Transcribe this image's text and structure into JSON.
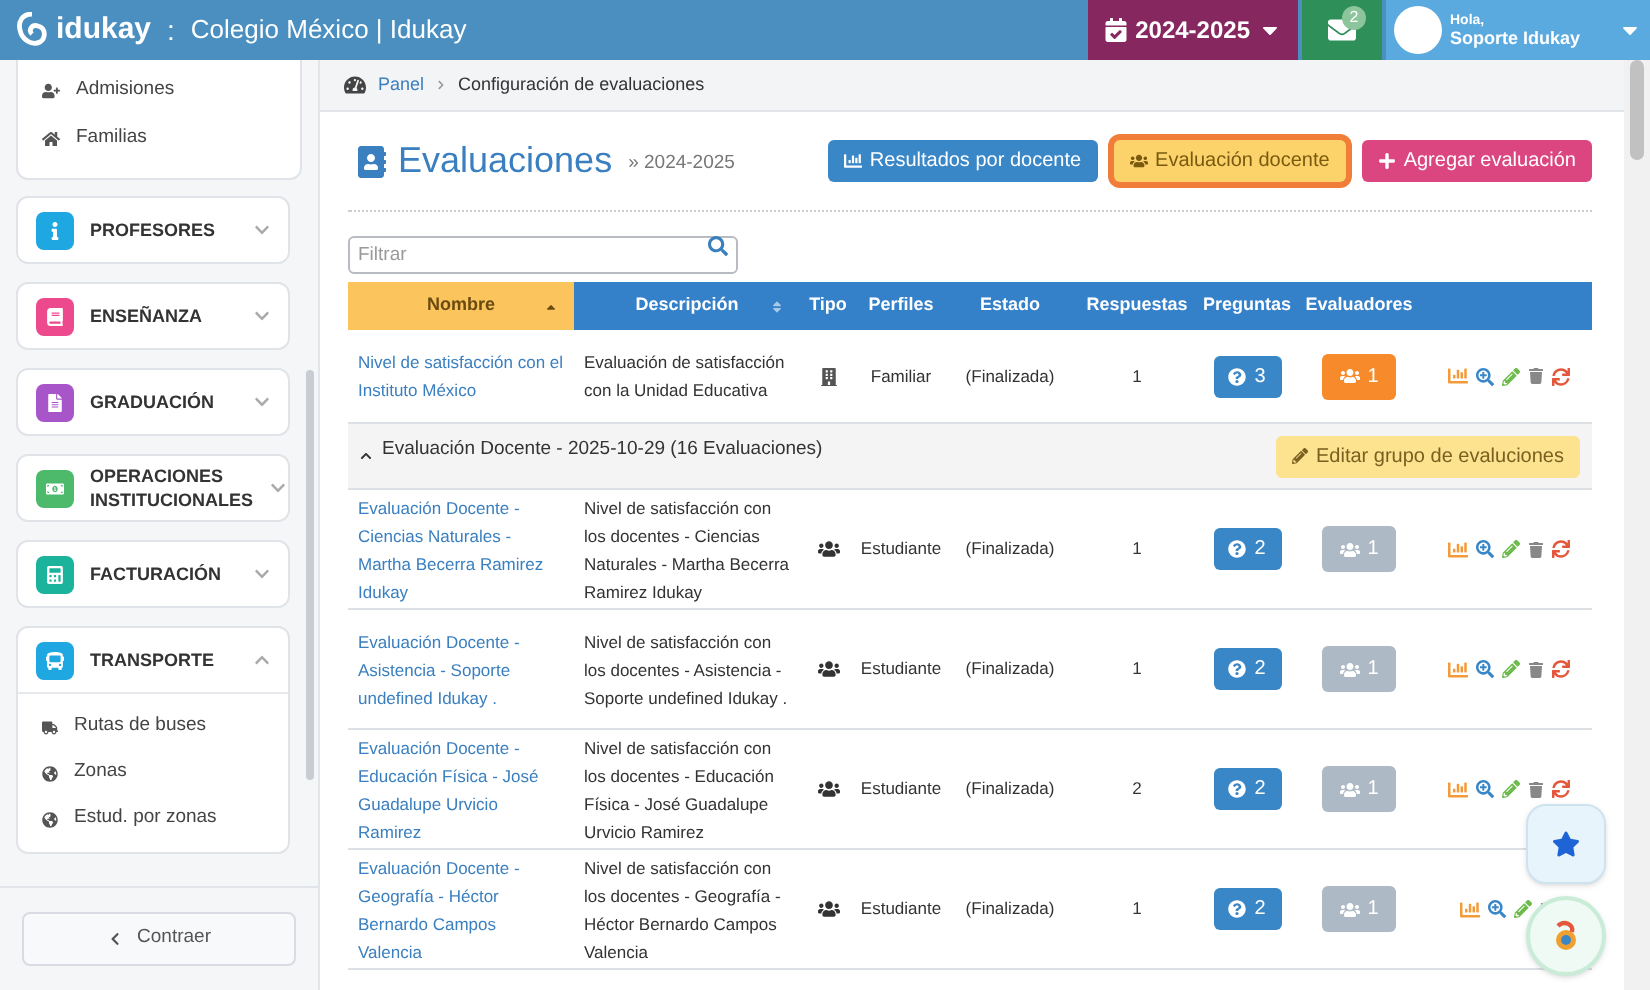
{
  "header": {
    "logo": "idukay",
    "separator": ":",
    "school": "Colegio México | Idukay",
    "year": "2024-2025",
    "mail_count": "2",
    "greeting": "Hola,",
    "user": "Soporte Idukay"
  },
  "sidebar": {
    "top_items": [
      "Admisiones",
      "Familias"
    ],
    "sections": [
      {
        "label": "PROFESORES",
        "color": "#1ea7e1",
        "expanded": false
      },
      {
        "label": "ENSEÑANZA",
        "color": "#ec4a8c",
        "expanded": false
      },
      {
        "label": "GRADUACIÓN",
        "color": "#a855c9",
        "expanded": false
      },
      {
        "label": "OPERACIONES INSTITUCIONALES",
        "color": "#4cba6a",
        "expanded": false
      },
      {
        "label": "FACTURACIÓN",
        "color": "#1bb39b",
        "expanded": false
      },
      {
        "label": "TRANSPORTE",
        "color": "#1ea7e1",
        "expanded": true,
        "children": [
          "Rutas de buses",
          "Zonas",
          "Estud. por zonas"
        ]
      }
    ],
    "collapse_button": "Contraer"
  },
  "breadcrumb": [
    "Panel",
    "Configuración de evaluaciones"
  ],
  "page": {
    "title": "Evaluaciones",
    "subtitle": "» 2024-2025",
    "buttons": [
      {
        "label": "Resultados por docente",
        "kind": "results",
        "selected": false
      },
      {
        "label": "Evaluación docente",
        "kind": "teacher",
        "selected": true
      },
      {
        "label": "Agregar evaluación",
        "kind": "add",
        "selected": false
      }
    ]
  },
  "filter": {
    "placeholder": "Filtrar"
  },
  "table": {
    "columns": [
      {
        "label": "Nombre",
        "selected": true,
        "sortable": true
      },
      {
        "label": "Descripción",
        "selected": false,
        "sortable": true
      },
      {
        "label": "Tipo",
        "selected": false,
        "sortable": false
      },
      {
        "label": "Perfiles",
        "selected": false,
        "sortable": false
      },
      {
        "label": "Estado",
        "selected": false,
        "sortable": false
      },
      {
        "label": "Respuestas",
        "selected": false,
        "sortable": false
      },
      {
        "label": "Preguntas",
        "selected": false,
        "sortable": false
      },
      {
        "label": "Evaluadores",
        "selected": false,
        "sortable": false
      }
    ],
    "rows": [
      {
        "kind": "institution",
        "name": "Nivel de satisfacción con el Instituto México",
        "description": "Evaluación de satisfacción con la Unidad Educativa",
        "profile": "Familiar",
        "status": "(Finalizada)",
        "responses": "1",
        "questions": "3",
        "evaluators": "1",
        "highlighted": true
      },
      {
        "kind": "group",
        "label": "Evaluación Docente - 2025-10-29 (16 Evaluaciones)",
        "expanded": true,
        "button": "Editar grupo de evaluciones"
      },
      {
        "kind": "teacher",
        "name": "Evaluación Docente - Ciencias Naturales - Martha Becerra Ramirez Idukay",
        "description": "Nivel de satisfacción con los docentes - Ciencias Naturales - Martha Becerra Ramirez Idukay",
        "profile": "Estudiante",
        "status": "(Finalizada)",
        "responses": "1",
        "questions": "2",
        "evaluators": "1",
        "highlighted": false
      },
      {
        "kind": "teacher",
        "name": "Evaluación Docente - Asistencia - Soporte undefined Idukay .",
        "description": "Nivel de satisfacción con los docentes - Asistencia - Soporte undefined Idukay .",
        "profile": "Estudiante",
        "status": "(Finalizada)",
        "responses": "1",
        "questions": "2",
        "evaluators": "1",
        "highlighted": false
      },
      {
        "kind": "teacher",
        "name": "Evaluación Docente - Educación Física - José Guadalupe Urvicio Ramirez",
        "description": "Nivel de satisfacción con los docentes - Educación Física - José Guadalupe Urvicio Ramirez",
        "profile": "Estudiante",
        "status": "(Finalizada)",
        "responses": "2",
        "questions": "2",
        "evaluators": "1",
        "highlighted": false
      },
      {
        "kind": "teacher",
        "name": "Evaluación Docente - Geografía - Héctor Bernardo Campos Valencia",
        "description": "Nivel de satisfacción con los docentes - Geografía - Héctor Bernardo Campos Valencia",
        "profile": "Estudiante",
        "status": "(Finalizada)",
        "responses": "1",
        "questions": "2",
        "evaluators": "1",
        "highlighted": false
      }
    ]
  }
}
